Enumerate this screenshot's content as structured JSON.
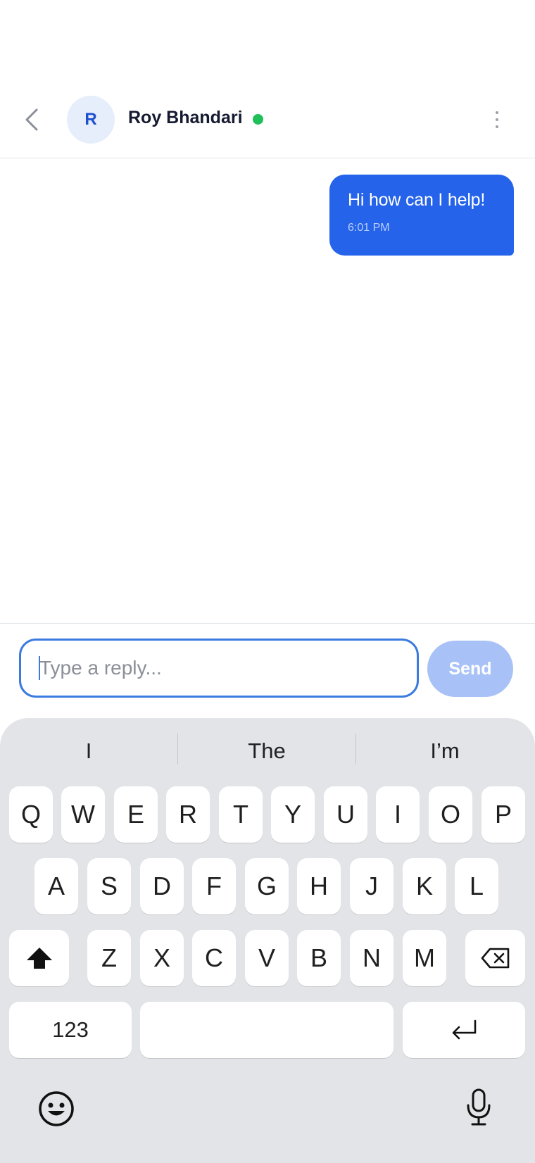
{
  "header": {
    "contact_name": "Roy Bhandari",
    "avatar_initial": "R",
    "status": "online"
  },
  "messages": [
    {
      "text": "Hi how can I help!",
      "time": "6:01 PM",
      "direction": "outgoing"
    }
  ],
  "composer": {
    "placeholder": "Type a reply...",
    "value": "",
    "send_label": "Send"
  },
  "keyboard": {
    "suggestions": [
      "I",
      "The",
      "I’m"
    ],
    "row1": [
      "Q",
      "W",
      "E",
      "R",
      "T",
      "Y",
      "U",
      "I",
      "O",
      "P"
    ],
    "row2": [
      "A",
      "S",
      "D",
      "F",
      "G",
      "H",
      "J",
      "K",
      "L"
    ],
    "row3": [
      "Z",
      "X",
      "C",
      "V",
      "B",
      "N",
      "M"
    ],
    "numbers_label": "123"
  },
  "colors": {
    "accent": "#2563eb",
    "send_disabled": "#a8c2f7",
    "online": "#1fc05a",
    "keyboard_bg": "#e3e4e7"
  },
  "icons": [
    "chevron-left-icon",
    "more-vert-icon",
    "shift-icon",
    "backspace-icon",
    "enter-icon",
    "emoji-icon",
    "mic-icon"
  ]
}
